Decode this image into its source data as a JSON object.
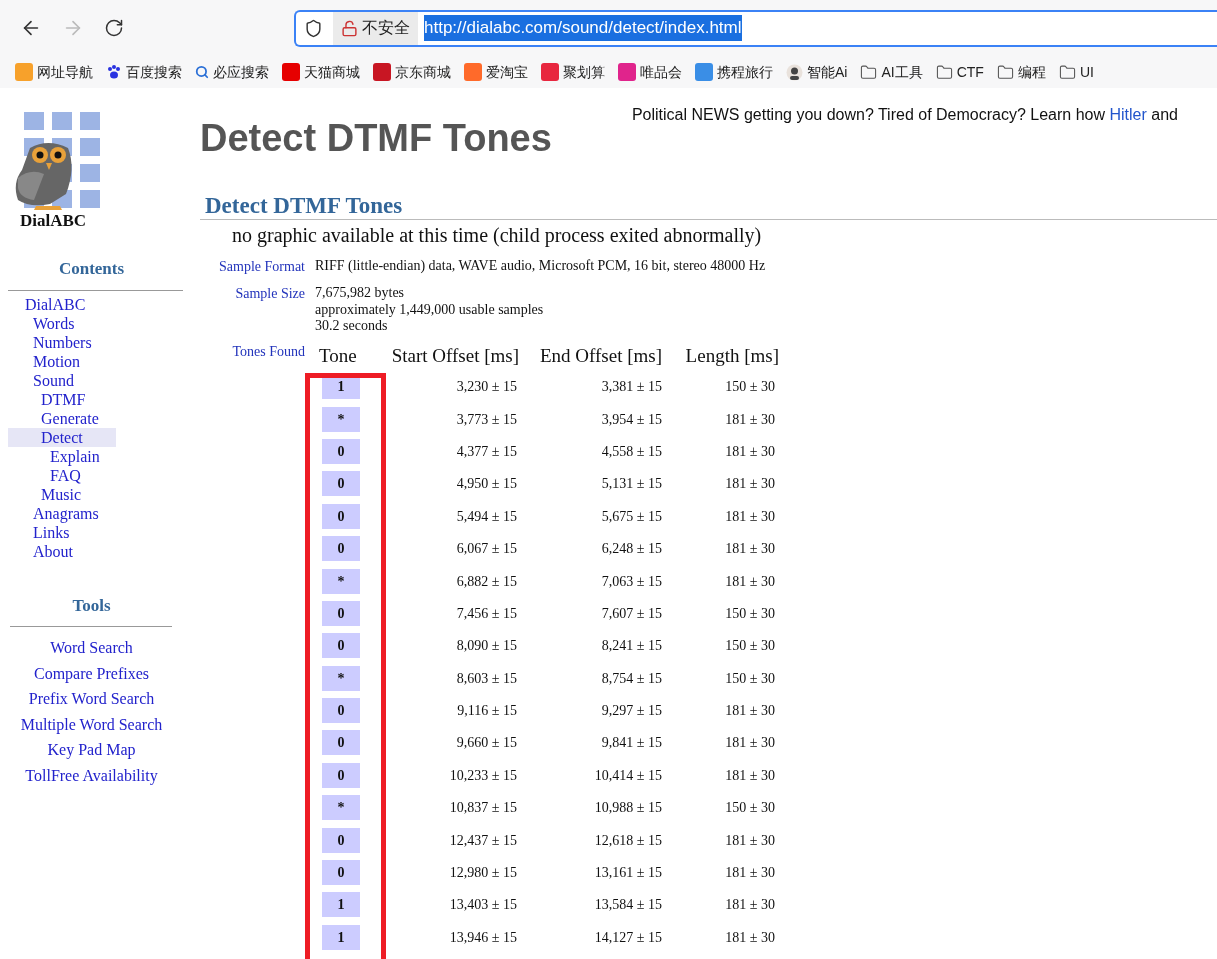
{
  "browser": {
    "back_disabled": false,
    "forward_disabled": true,
    "security": "不安全",
    "url": "http://dialabc.com/sound/detect/index.html",
    "url_selected": true
  },
  "bookmarks": [
    {
      "label": "网址导航",
      "kind": "site",
      "color": "#f7a12b"
    },
    {
      "label": "百度搜索",
      "kind": "paw",
      "color": "#2932e1"
    },
    {
      "label": "必应搜索",
      "kind": "search",
      "color": "#2a6fd6"
    },
    {
      "label": "天猫商城",
      "kind": "site",
      "color": "#e60000"
    },
    {
      "label": "京东商城",
      "kind": "site",
      "color": "#c81623"
    },
    {
      "label": "爱淘宝",
      "kind": "site",
      "color": "#ff6a2a"
    },
    {
      "label": "聚划算",
      "kind": "site",
      "color": "#e8273f"
    },
    {
      "label": "唯品会",
      "kind": "site",
      "color": "#e0248c"
    },
    {
      "label": "携程旅行",
      "kind": "site",
      "color": "#3a8ee6"
    },
    {
      "label": "智能Ai",
      "kind": "avatar",
      "color": "#444444"
    },
    {
      "label": "AI工具",
      "kind": "folder"
    },
    {
      "label": "CTF",
      "kind": "folder"
    },
    {
      "label": "编程",
      "kind": "folder"
    },
    {
      "label": "UI",
      "kind": "folder"
    }
  ],
  "logo": {
    "text": "DialABC"
  },
  "contents": {
    "title": "Contents",
    "items": [
      {
        "label": "DialABC",
        "selected": false,
        "children": [
          {
            "label": "Words",
            "selected": false
          },
          {
            "label": "Numbers",
            "selected": false
          },
          {
            "label": "Motion",
            "selected": false
          },
          {
            "label": "Sound",
            "selected": false,
            "children": [
              {
                "label": "DTMF",
                "selected": false
              },
              {
                "label": "Generate",
                "selected": false
              },
              {
                "label": "Detect",
                "selected": true,
                "children": [
                  {
                    "label": "Explain",
                    "selected": false
                  },
                  {
                    "label": "FAQ",
                    "selected": false
                  }
                ]
              },
              {
                "label": "Music",
                "selected": false
              }
            ]
          },
          {
            "label": "Anagrams",
            "selected": false
          },
          {
            "label": "Links",
            "selected": false
          },
          {
            "label": "About",
            "selected": false
          }
        ]
      }
    ]
  },
  "tools": {
    "title": "Tools",
    "items": [
      "Word Search",
      "Compare Prefixes",
      "Prefix Word Search",
      "Multiple Word Search",
      "Key Pad Map",
      "TollFree Availability"
    ]
  },
  "banner": {
    "text": "Political NEWS getting you down? Tired of Democracy? Learn how",
    "link": "Hitler",
    "tail": "and"
  },
  "page_title": "Detect DTMF Tones",
  "section_title": "Detect DTMF Tones",
  "notice": "no graphic available at this time (child process exited abnormally)",
  "details": [
    {
      "label": "Sample Format",
      "lines": [
        "RIFF (little-endian) data, WAVE audio, Microsoft PCM, 16 bit, stereo 48000 Hz"
      ]
    },
    {
      "label": "Sample Size",
      "lines": [
        "7,675,982 bytes",
        "approximately 1,449,000 usable samples",
        "30.2 seconds"
      ]
    }
  ],
  "tones": {
    "label": "Tones Found",
    "columns": [
      "Tone",
      "Start Offset [ms]",
      "End Offset [ms]",
      "Length [ms]"
    ],
    "rows": [
      [
        "1",
        "3,230 ± 15",
        "3,381 ± 15",
        "150 ± 30"
      ],
      [
        "*",
        "3,773 ± 15",
        "3,954 ± 15",
        "181 ± 30"
      ],
      [
        "0",
        "4,377 ± 15",
        "4,558 ± 15",
        "181 ± 30"
      ],
      [
        "0",
        "4,950 ± 15",
        "5,131 ± 15",
        "181 ± 30"
      ],
      [
        "0",
        "5,494 ± 15",
        "5,675 ± 15",
        "181 ± 30"
      ],
      [
        "0",
        "6,067 ± 15",
        "6,248 ± 15",
        "181 ± 30"
      ],
      [
        "*",
        "6,882 ± 15",
        "7,063 ± 15",
        "181 ± 30"
      ],
      [
        "0",
        "7,456 ± 15",
        "7,607 ± 15",
        "150 ± 30"
      ],
      [
        "0",
        "8,090 ± 15",
        "8,241 ± 15",
        "150 ± 30"
      ],
      [
        "*",
        "8,603 ± 15",
        "8,754 ± 15",
        "150 ± 30"
      ],
      [
        "0",
        "9,116 ± 15",
        "9,297 ± 15",
        "181 ± 30"
      ],
      [
        "0",
        "9,660 ± 15",
        "9,841 ± 15",
        "181 ± 30"
      ],
      [
        "0",
        "10,233 ± 15",
        "10,414 ± 15",
        "181 ± 30"
      ],
      [
        "*",
        "10,837 ± 15",
        "10,988 ± 15",
        "150 ± 30"
      ],
      [
        "0",
        "12,437 ± 15",
        "12,618 ± 15",
        "181 ± 30"
      ],
      [
        "0",
        "12,980 ± 15",
        "13,161 ± 15",
        "181 ± 30"
      ],
      [
        "1",
        "13,403 ± 15",
        "13,584 ± 15",
        "181 ± 30"
      ],
      [
        "1",
        "13,946 ± 15",
        "14,127 ± 15",
        "181 ± 30"
      ]
    ]
  }
}
